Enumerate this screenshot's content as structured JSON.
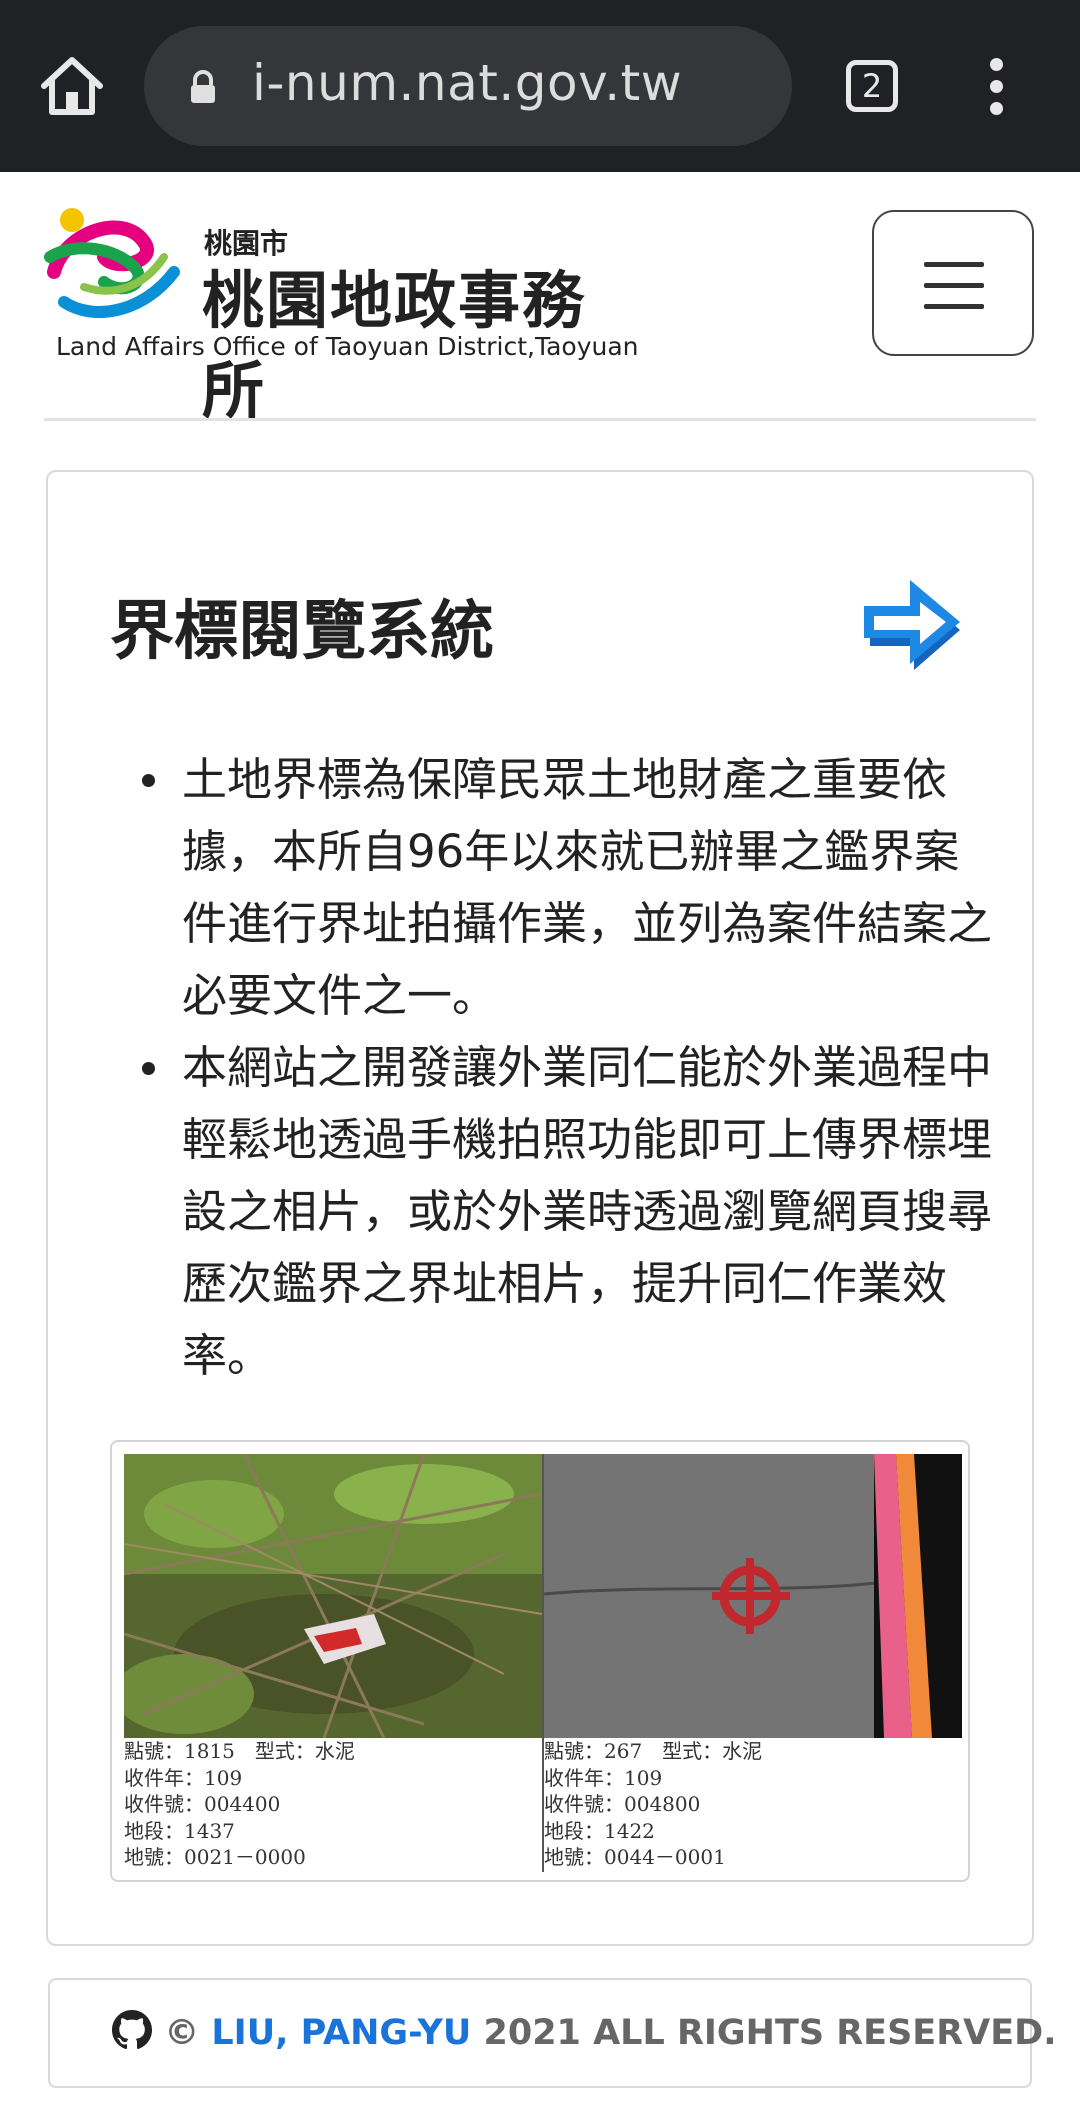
{
  "browser": {
    "url": "i-num.nat.gov.tw",
    "tab_count": "2"
  },
  "site": {
    "logo_city": "桃園市",
    "logo_name": "桃園地政事務所",
    "logo_english": "Land Affairs Office of Taoyuan District,Taoyuan"
  },
  "card": {
    "title": "界標閱覽系統",
    "bullets": [
      "土地界標為保障民眾土地財產之重要依據，本所自96年以來就已辦畢之鑑界案件進行界址拍攝作業，並列為案件結案之必要文件之一。",
      "本網站之開發讓外業同仁能於外業過程中輕鬆地透過手機拍照功能即可上傳界標埋設之相片，或於外業時透過瀏覽網頁搜尋歷次鑑界之界址相片，提升同仁作業效率。"
    ],
    "photos": [
      {
        "point_line": "點號：1815　型式：水泥",
        "year_line": "收件年：109",
        "receipt_line": "收件號：004400",
        "section_line": "地段：1437",
        "land_line": "地號：0021－0000"
      },
      {
        "point_line": "點號：267　型式：水泥",
        "year_line": "收件年：109",
        "receipt_line": "收件號：004800",
        "section_line": "地段：1422",
        "land_line": "地號：0044－0001"
      }
    ]
  },
  "footer": {
    "copyright_symbol": "©",
    "author": "LIU, PANG-YU",
    "rights": "2021 ALL RIGHTS RESERVED."
  },
  "icons": {
    "home": "home-icon",
    "lock": "lock-icon",
    "menu": "hamburger-icon",
    "arrow": "right-arrow-icon",
    "github": "github-icon"
  },
  "colors": {
    "chrome_bg": "#202124",
    "accent_blue": "#1a73d9",
    "arrow_blue": "#1e88e5"
  }
}
